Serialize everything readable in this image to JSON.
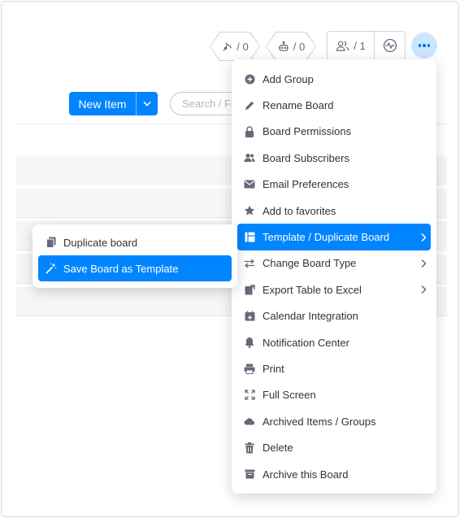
{
  "header": {
    "automations_count": "/ 0",
    "integrations_count": "/ 0",
    "members_count": "/ 1",
    "icons": {
      "automations": "robot-arm-icon",
      "integrations": "robot-icon",
      "members": "people-icon",
      "activity": "activity-icon",
      "more": "more-dots-icon"
    }
  },
  "toolbar": {
    "new_item_label": "New Item",
    "search_placeholder": "Search / Filter"
  },
  "menu": {
    "items": [
      {
        "label": "Add Group",
        "icon": "plus-circle-icon"
      },
      {
        "label": "Rename Board",
        "icon": "pencil-icon"
      },
      {
        "label": "Board Permissions",
        "icon": "lock-icon"
      },
      {
        "label": "Board Subscribers",
        "icon": "people-icon"
      },
      {
        "label": "Email Preferences",
        "icon": "envelope-icon"
      },
      {
        "label": "Add to favorites",
        "icon": "star-icon"
      },
      {
        "label": "Template / Duplicate Board",
        "icon": "template-icon",
        "active": true,
        "submenu": true
      },
      {
        "label": "Change Board Type",
        "icon": "swap-icon",
        "submenu": true
      },
      {
        "label": "Export Table to Excel",
        "icon": "export-icon",
        "submenu": true
      },
      {
        "label": "Calendar Integration",
        "icon": "calendar-icon"
      },
      {
        "label": "Notification Center",
        "icon": "bell-icon"
      },
      {
        "label": "Print",
        "icon": "printer-icon"
      },
      {
        "label": "Full Screen",
        "icon": "fullscreen-icon"
      },
      {
        "label": "Archived Items / Groups",
        "icon": "cloud-icon"
      },
      {
        "label": "Delete",
        "icon": "trash-icon"
      },
      {
        "label": "Archive this Board",
        "icon": "archive-box-icon"
      }
    ]
  },
  "submenu": {
    "items": [
      {
        "label": "Duplicate board",
        "icon": "duplicate-icon"
      },
      {
        "label": "Save Board as Template",
        "icon": "magic-wand-icon",
        "active": true
      }
    ]
  },
  "colors": {
    "accent": "#0085ff",
    "more_button_bg": "#cce5ff",
    "text": "#323338",
    "muted": "#676879"
  }
}
